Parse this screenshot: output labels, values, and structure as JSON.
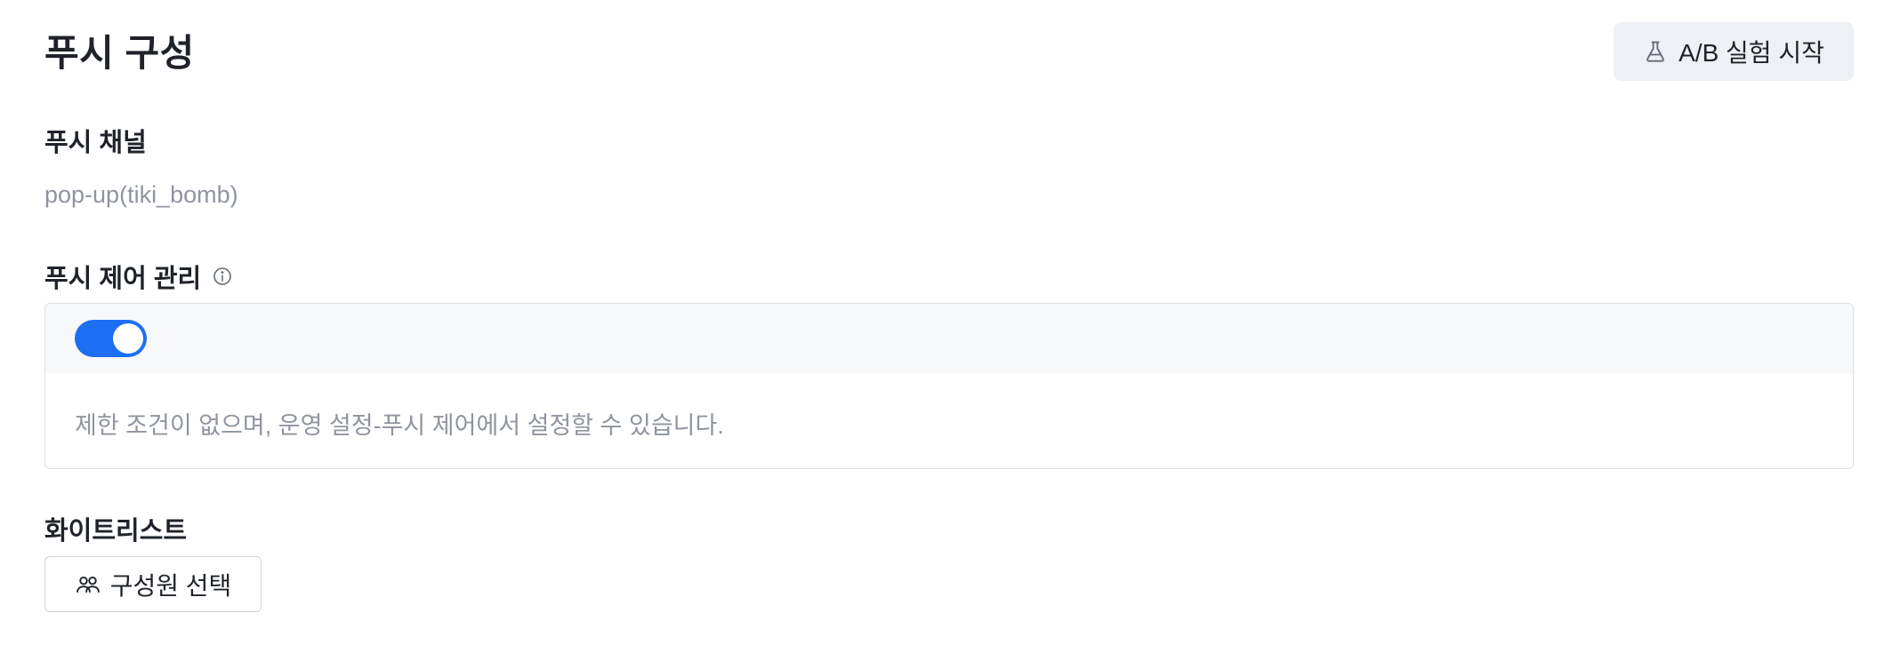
{
  "header": {
    "title": "푸시 구성",
    "ab_button": {
      "label": "A/B 실험 시작",
      "icon": "flask-icon"
    }
  },
  "push_channel": {
    "label": "푸시 채널",
    "value": "pop-up(tiki_bomb)"
  },
  "push_control": {
    "label": "푸시 제어 관리",
    "info_icon": "info-icon",
    "toggle_on": true,
    "description": "제한 조건이 없으며, 운영 설정-푸시 제어에서 설정할 수 있습니다."
  },
  "whitelist": {
    "label": "화이트리스트",
    "button": {
      "label": "구성원 선택",
      "icon": "users-icon"
    }
  },
  "colors": {
    "accent": "#1d6ff2",
    "text_primary": "#1f2329",
    "text_secondary": "#8f959e",
    "button_bg": "#eff0f5",
    "panel_header_bg": "#f7f8fa",
    "border": "#dee0e3"
  }
}
